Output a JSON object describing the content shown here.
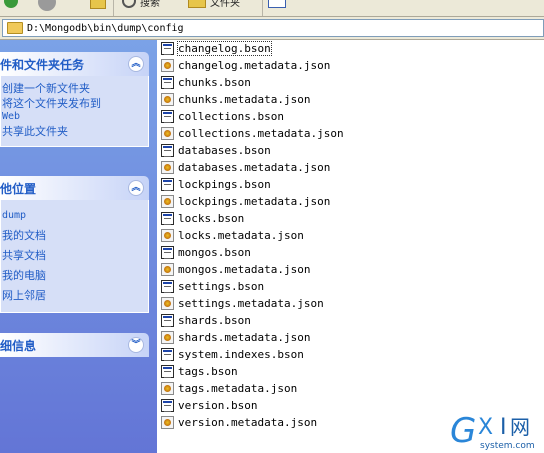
{
  "toolbar": {
    "back_label": "后退",
    "search_label": "搜索",
    "folders_label": "文件夹"
  },
  "address": {
    "path": "D:\\Mongodb\\bin\\dump\\config"
  },
  "left_pane": {
    "file_tasks": {
      "title": "件和文件夹任务",
      "items": [
        "创建一个新文件夹",
        "将这个文件夹发布到",
        "Web",
        "共享此文件夹"
      ]
    },
    "other_places": {
      "title": "他位置",
      "items": [
        "dump",
        "我的文档",
        "共享文档",
        "我的电脑",
        "网上邻居"
      ]
    },
    "details": {
      "title": "细信息"
    }
  },
  "files": [
    {
      "name": "changelog.bson",
      "type": "bson"
    },
    {
      "name": "changelog.metadata.json",
      "type": "json"
    },
    {
      "name": "chunks.bson",
      "type": "bson"
    },
    {
      "name": "chunks.metadata.json",
      "type": "json"
    },
    {
      "name": "collections.bson",
      "type": "bson"
    },
    {
      "name": "collections.metadata.json",
      "type": "json"
    },
    {
      "name": "databases.bson",
      "type": "bson"
    },
    {
      "name": "databases.metadata.json",
      "type": "json"
    },
    {
      "name": "lockpings.bson",
      "type": "bson"
    },
    {
      "name": "lockpings.metadata.json",
      "type": "json"
    },
    {
      "name": "locks.bson",
      "type": "bson"
    },
    {
      "name": "locks.metadata.json",
      "type": "json"
    },
    {
      "name": "mongos.bson",
      "type": "bson"
    },
    {
      "name": "mongos.metadata.json",
      "type": "json"
    },
    {
      "name": "settings.bson",
      "type": "bson"
    },
    {
      "name": "settings.metadata.json",
      "type": "json"
    },
    {
      "name": "shards.bson",
      "type": "bson"
    },
    {
      "name": "shards.metadata.json",
      "type": "json"
    },
    {
      "name": "system.indexes.bson",
      "type": "bson"
    },
    {
      "name": "tags.bson",
      "type": "bson"
    },
    {
      "name": "tags.metadata.json",
      "type": "json"
    },
    {
      "name": "version.bson",
      "type": "bson"
    },
    {
      "name": "version.metadata.json",
      "type": "json"
    }
  ],
  "watermark": {
    "brand": "GXI网",
    "domain": "system.com"
  },
  "colors": {
    "task_link": "#215dc6",
    "left_bg_top": "#7ba2e7",
    "left_bg_bottom": "#6375d6"
  }
}
